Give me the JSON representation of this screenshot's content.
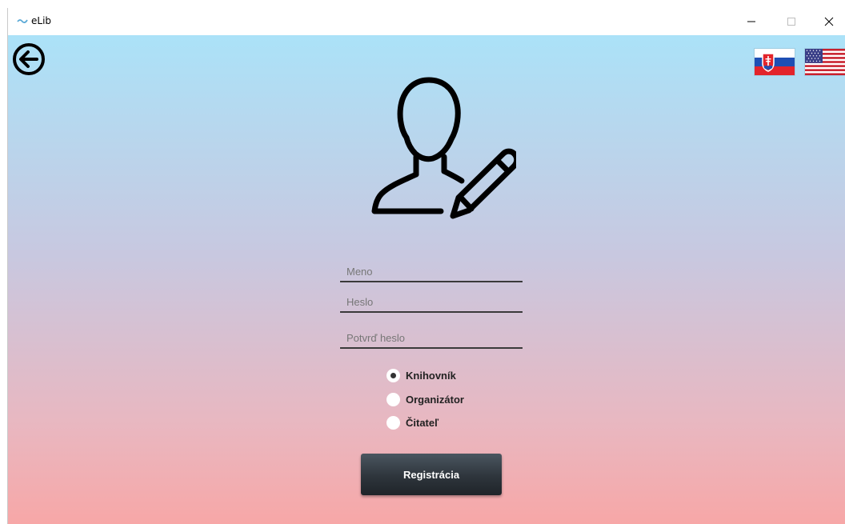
{
  "window": {
    "title": "eLib",
    "icon": "app-logo-icon",
    "controls": [
      "minimize-icon",
      "maximize-icon",
      "close-icon"
    ]
  },
  "nav": {
    "back_icon": "back-arrow-circle-icon"
  },
  "languages": [
    {
      "code": "sk",
      "icon": "flag-slovakia-icon"
    },
    {
      "code": "en",
      "icon": "flag-usa-icon"
    }
  ],
  "header_icon": "user-edit-icon",
  "form": {
    "name": {
      "placeholder": "Meno",
      "value": ""
    },
    "password": {
      "placeholder": "Heslo",
      "value": ""
    },
    "confirm_password": {
      "placeholder": "Potvrď heslo",
      "value": ""
    }
  },
  "roles": [
    {
      "label": "Knihovník",
      "checked": true
    },
    {
      "label": "Organizátor",
      "checked": false
    },
    {
      "label": "Čitateľ",
      "checked": false
    }
  ],
  "submit_label": "Registrácia",
  "colors": {
    "gradient_top": "#abe2f8",
    "gradient_bottom": "#f7a7a7",
    "button": "#2e353c"
  }
}
